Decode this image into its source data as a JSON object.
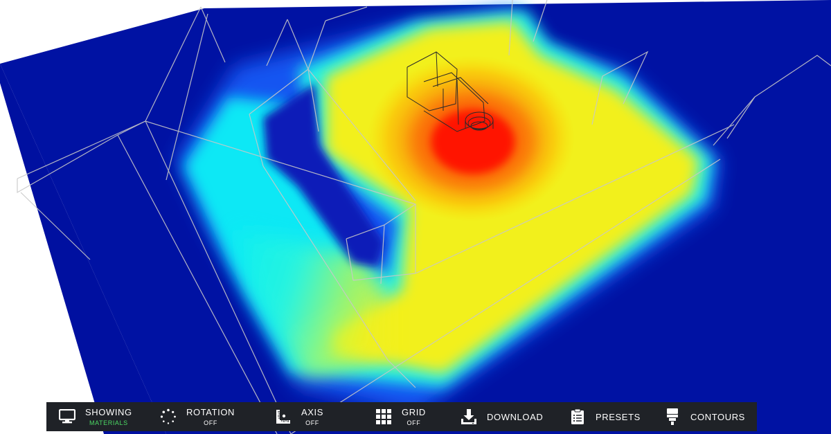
{
  "toolbar": {
    "items": [
      {
        "id": "showing",
        "label": "SHOWING",
        "sub": "MATERIALS",
        "icon": "monitor-icon"
      },
      {
        "id": "rotation",
        "label": "ROTATION",
        "sub": "OFF",
        "icon": "rotation-icon"
      },
      {
        "id": "axis",
        "label": "AXIS",
        "sub": "OFF",
        "icon": "axis-ruler-icon"
      },
      {
        "id": "grid",
        "label": "GRID",
        "sub": "OFF",
        "icon": "grid-icon"
      },
      {
        "id": "download",
        "label": "DOWNLOAD",
        "icon": "download-icon"
      },
      {
        "id": "presets",
        "label": "PRESETS",
        "icon": "clipboard-icon"
      },
      {
        "id": "contours",
        "label": "CONTOURS",
        "icon": "contours-icon"
      }
    ]
  },
  "colors": {
    "toolbar_bg": "#1f2227",
    "active_sub": "#4cd964",
    "plane_base": "#0010a0",
    "heat_low": "#00e5ff",
    "heat_mid": "#f5f21a",
    "heat_high": "#ff0000"
  }
}
